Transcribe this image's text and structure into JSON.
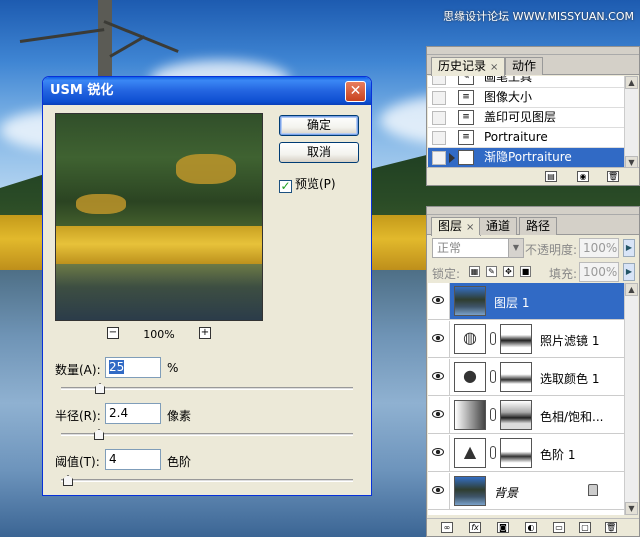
{
  "watermark": "思缘设计论坛 WWW.MISSYUAN.COM",
  "usm_dialog": {
    "title": "USM 锐化",
    "ok_label": "确定",
    "cancel_label": "取消",
    "preview_label": "预览(P)",
    "preview_checked": true,
    "zoom_minus": "−",
    "zoom_plus": "+",
    "zoom": "100%",
    "amount_label": "数量(A):",
    "amount_value": "25",
    "amount_unit": "%",
    "radius_label": "半径(R):",
    "radius_value": "2.4",
    "radius_unit": "像素",
    "threshold_label": "阈值(T):",
    "threshold_value": "4",
    "threshold_unit": "色阶"
  },
  "history_panel": {
    "tabs": [
      {
        "label": "历史记录",
        "active": true,
        "close": "×"
      },
      {
        "label": "动作",
        "active": false
      }
    ],
    "items": [
      {
        "label": "画笔工具",
        "icon": "brush-icon"
      },
      {
        "label": "图像大小",
        "icon": "history-state-icon"
      },
      {
        "label": "盖印可见图层",
        "icon": "history-state-icon"
      },
      {
        "label": "Portraiture",
        "icon": "history-state-icon"
      },
      {
        "label": "渐隐Portraiture",
        "icon": "history-state-icon",
        "selected": true
      }
    ]
  },
  "layers_panel": {
    "tabs": [
      {
        "label": "图层",
        "active": true,
        "close": "×"
      },
      {
        "label": "通道",
        "active": false
      },
      {
        "label": "路径",
        "active": false
      }
    ],
    "blend_mode": "正常",
    "opacity_label": "不透明度:",
    "opacity_value": "100%",
    "lock_label": "锁定:",
    "fill_label": "填充:",
    "fill_value": "100%",
    "layers": [
      {
        "name": "图层 1",
        "type": "image",
        "selected": true
      },
      {
        "name": "照片滤镜 1",
        "type": "adjustment",
        "icon": "photo-filter-icon"
      },
      {
        "name": "选取颜色 1",
        "type": "adjustment",
        "icon": "selective-color-icon"
      },
      {
        "name": "色相/饱和...",
        "type": "adjustment",
        "icon": "hue-saturation-icon"
      },
      {
        "name": "色阶 1",
        "type": "adjustment",
        "icon": "levels-icon"
      },
      {
        "name": "背景",
        "type": "background",
        "locked": true
      }
    ]
  }
}
